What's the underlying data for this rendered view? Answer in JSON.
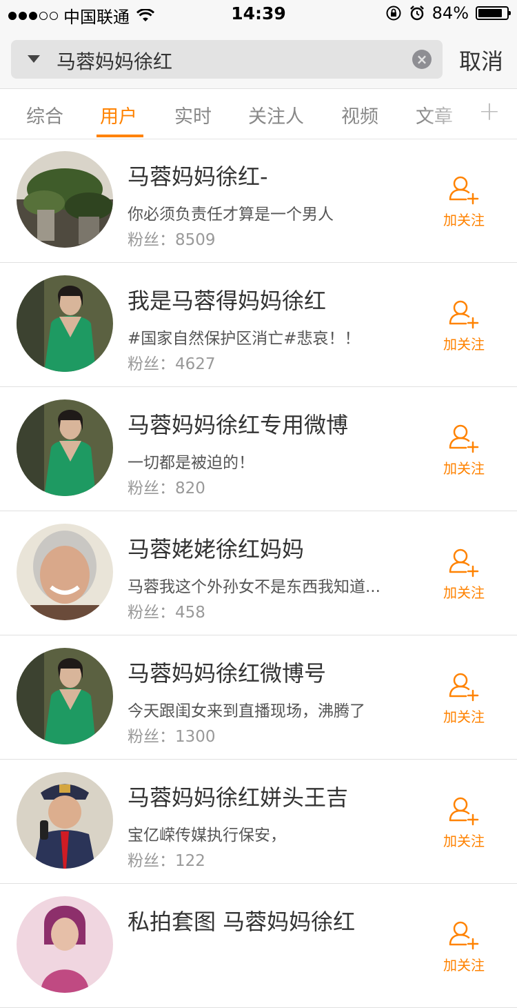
{
  "status_bar": {
    "carrier": "中国联通",
    "time": "14:39",
    "battery": "84%",
    "battery_level": 0.84
  },
  "search": {
    "query": "马蓉妈妈徐红",
    "cancel_label": "取消"
  },
  "tabs": [
    {
      "label": "综合"
    },
    {
      "label": "用户"
    },
    {
      "label": "实时"
    },
    {
      "label": "关注人"
    },
    {
      "label": "视频"
    },
    {
      "label": "文章"
    }
  ],
  "follow_label": "加关注",
  "fans_label": "粉丝：",
  "users": [
    {
      "name": "马蓉妈妈徐红-",
      "desc": "你必须负责任才算是一个男人",
      "fans": "8509",
      "avatar": "scenery"
    },
    {
      "name": "我是马蓉得妈妈徐红",
      "desc": "#国家自然保护区消亡#悲哀！！",
      "fans": "4627",
      "avatar": "woman-green"
    },
    {
      "name": "马蓉妈妈徐红专用微博",
      "desc": "一切都是被迫的！",
      "fans": "820",
      "avatar": "woman-green"
    },
    {
      "name": "马蓉姥姥徐红妈妈",
      "desc": "马蓉我这个外孙女不是东西我知道...",
      "fans": "458",
      "avatar": "elderly-woman"
    },
    {
      "name": "马蓉妈妈徐红微博号",
      "desc": "今天跟闺女来到直播现场，沸腾了",
      "fans": "1300",
      "avatar": "woman-green"
    },
    {
      "name": "马蓉妈妈徐红姘头王吉",
      "desc": "宝亿嵘传媒执行保安，",
      "fans": "122",
      "avatar": "security-guard"
    },
    {
      "name": "私拍套图 马蓉妈妈徐红",
      "desc": "",
      "fans": "",
      "avatar": "woman-pink"
    }
  ]
}
